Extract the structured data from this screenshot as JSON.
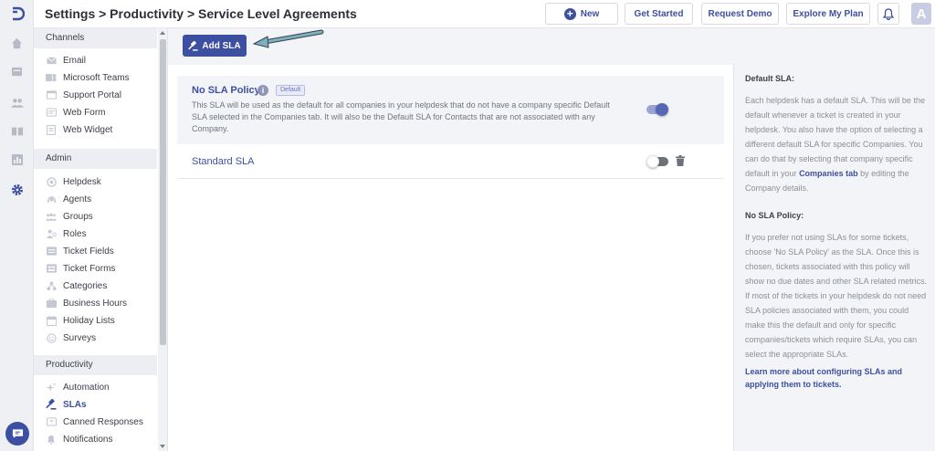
{
  "header": {
    "breadcrumb": "Settings > Productivity > Service Level Agreements",
    "buttons": {
      "new": "New",
      "get_started": "Get Started",
      "request_demo": "Request Demo",
      "explore_plan": "Explore My Plan"
    },
    "avatar_initial": "A"
  },
  "rail": {
    "icons": [
      "logo-icon",
      "home-icon",
      "tickets-icon",
      "contacts-icon",
      "knowledge-base-icon",
      "reports-icon",
      "settings-icon",
      "chat-icon"
    ]
  },
  "sidebar": {
    "channels": {
      "title": "Channels",
      "items": [
        "Email",
        "Microsoft Teams",
        "Support Portal",
        "Web Form",
        "Web Widget"
      ]
    },
    "admin": {
      "title": "Admin",
      "items": [
        "Helpdesk",
        "Agents",
        "Groups",
        "Roles",
        "Ticket Fields",
        "Ticket Forms",
        "Categories",
        "Business Hours",
        "Holiday Lists",
        "Surveys"
      ]
    },
    "productivity": {
      "title": "Productivity",
      "items": [
        "Automation",
        "SLAs",
        "Canned Responses",
        "Notifications"
      ],
      "active": "SLAs"
    }
  },
  "main": {
    "add_sla_label": "Add SLA",
    "policies": [
      {
        "name": "No SLA Policy",
        "badge": "Default",
        "description": "This SLA will be used as the default for all companies in your helpdesk that do not have a company specific Default SLA selected in the Companies tab. It will also be the Default SLA for Contacts that are not associated with any Company.",
        "enabled": true
      },
      {
        "name": "Standard SLA",
        "enabled": false
      }
    ]
  },
  "info_panel": {
    "default_title": "Default SLA:",
    "default_text_1": "Each helpdesk has a default SLA. This will be the default whenever a ticket is created in your helpdesk. You also have the option of selecting a different default SLA for specific Companies. You can do that by selecting that company specific default in your",
    "companies_link": "Companies tab",
    "default_text_2": "by editing the Company details.",
    "no_sla_title": "No SLA Policy:",
    "no_sla_text": "If you prefer not using SLAs for some tickets, choose 'No SLA Policy' as the SLA. Once this is chosen, tickets associated with this policy will show no due dates and other SLA related metrics. If most of the tickets in your helpdesk do not need SLA policies associated with them, you could make this the default and only for specific companies/tickets which require SLAs, you can select the appropriate SLAs.",
    "learn_more": "Learn more about configuring SLAs and applying them to tickets."
  },
  "colors": {
    "accent": "#3d4fa0",
    "muted_text": "#8a8f99",
    "panel_bg": "#f3f4f7"
  }
}
